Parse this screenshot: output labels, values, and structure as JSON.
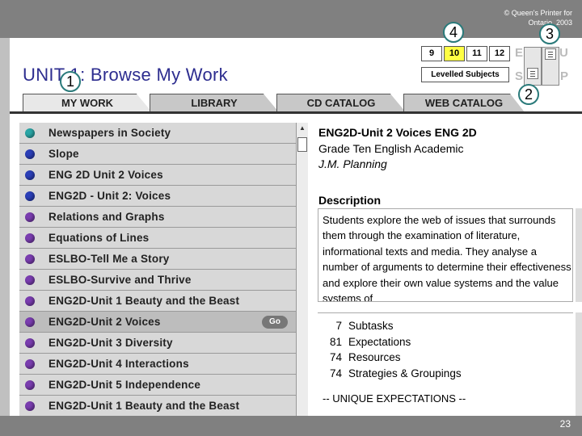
{
  "header": {
    "copyright": "© Queen's Printer for Ontario, 2003",
    "title": "UNIT 1: Browse My Work"
  },
  "callouts": [
    "1",
    "2",
    "3",
    "4"
  ],
  "grades": [
    {
      "label": "9",
      "active": false
    },
    {
      "label": "10",
      "active": true
    },
    {
      "label": "11",
      "active": false
    },
    {
      "label": "12",
      "active": false
    }
  ],
  "levelled_subjects": "Levelled Subjects",
  "ghost_letters": [
    "E",
    "U",
    "S",
    "P"
  ],
  "tabs": [
    "MY WORK",
    "LIBRARY",
    "CD CATALOG",
    "WEB CATALOG"
  ],
  "list": {
    "items": [
      {
        "label": "Newspapers in Society",
        "color": "#2aa6a6"
      },
      {
        "label": "Slope",
        "color": "#2b3fb8"
      },
      {
        "label": "ENG 2D Unit 2 Voices",
        "color": "#2b3fb8"
      },
      {
        "label": "ENG2D - Unit 2: Voices",
        "color": "#2b3fb8"
      },
      {
        "label": "Relations and Graphs",
        "color": "#7a3db0"
      },
      {
        "label": "Equations of Lines",
        "color": "#7a3db0"
      },
      {
        "label": "ESLBO-Tell Me a Story",
        "color": "#7a3db0"
      },
      {
        "label": "ESLBO-Survive and Thrive",
        "color": "#7a3db0"
      },
      {
        "label": "ENG2D-Unit 1  Beauty and the Beast",
        "color": "#7a3db0"
      },
      {
        "label": "ENG2D-Unit 2  Voices",
        "color": "#7a3db0"
      },
      {
        "label": "ENG2D-Unit 3  Diversity",
        "color": "#7a3db0"
      },
      {
        "label": "ENG2D-Unit 4  Interactions",
        "color": "#7a3db0"
      },
      {
        "label": "ENG2D-Unit 5  Independence",
        "color": "#7a3db0"
      },
      {
        "label": "ENG2D-Unit 1  Beauty and the Beast",
        "color": "#7a3db0"
      }
    ],
    "selected_index": 9,
    "go_label": "Go"
  },
  "detail": {
    "title": "ENG2D-Unit 2  Voices      ENG 2D",
    "grade": "Grade Ten English Academic",
    "author": "J.M. Planning",
    "description_heading": "Description",
    "description": "Students explore the web of issues that surrounds them through the examination of literature, informational texts and media.  They analyse a number of arguments to determine their effectiveness and explore their own value systems and the value systems of",
    "counts": [
      {
        "num": "7",
        "label": "Subtasks"
      },
      {
        "num": "81",
        "label": "Expectations"
      },
      {
        "num": "74",
        "label": "Resources"
      },
      {
        "num": "74",
        "label": "Strategies & Groupings"
      }
    ],
    "unique_expectations": "-- UNIQUE EXPECTATIONS --"
  },
  "slide_number": "23"
}
